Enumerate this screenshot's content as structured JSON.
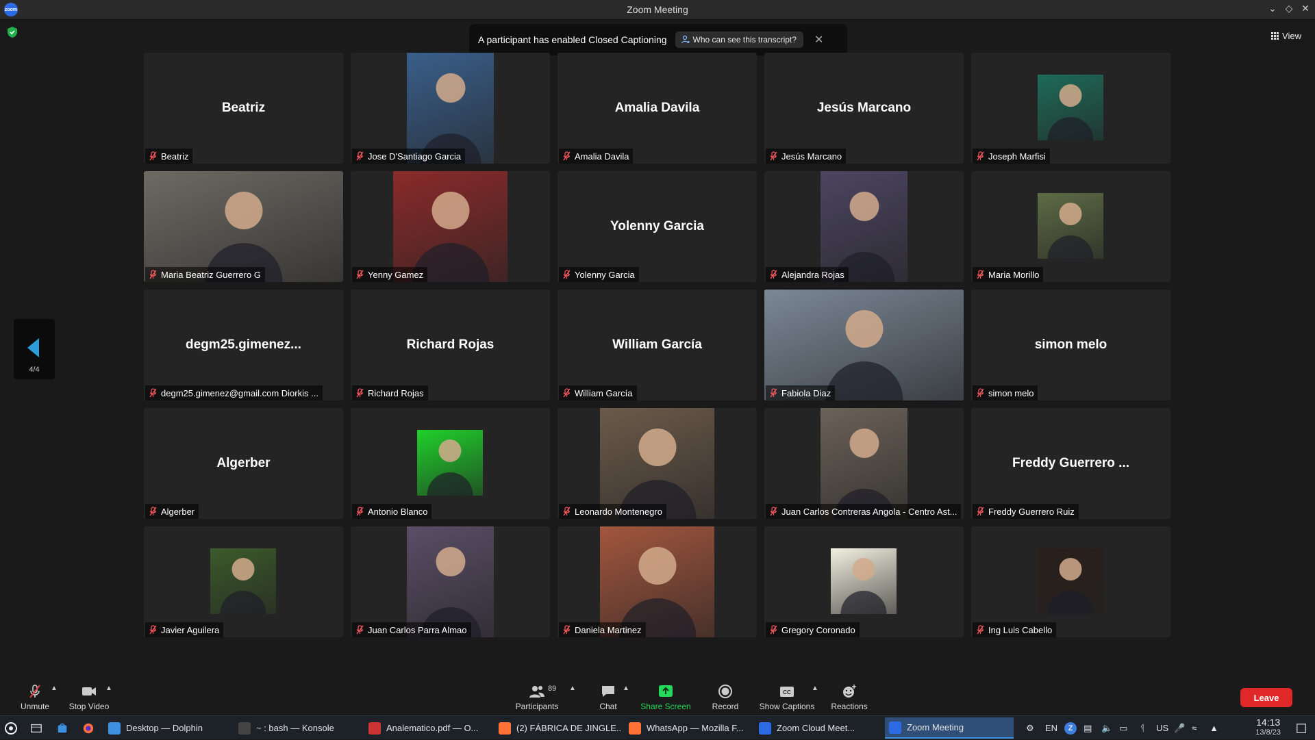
{
  "window": {
    "title": "Zoom Meeting",
    "logo_text": "zoom"
  },
  "banner": {
    "message": "A participant has enabled Closed Captioning",
    "who_label": "Who can see this transcript?"
  },
  "view": {
    "label": "View"
  },
  "pager": {
    "page": "4/4"
  },
  "tiles": [
    {
      "big": "Beatriz",
      "name": "Beatriz"
    },
    {
      "big": "",
      "name": "Jose D'Santiago Garcia",
      "video": "#3a5f8a"
    },
    {
      "big": "Amalia Davila",
      "name": "Amalia Davila"
    },
    {
      "big": "Jesús Marcano",
      "name": "Jesús Marcano"
    },
    {
      "big": "",
      "name": "Joseph Marfisi",
      "video": "#1e6b58"
    },
    {
      "big": "",
      "name": "Maria Beatriz Guerrero G",
      "video": "#6d6a63"
    },
    {
      "big": "",
      "name": "Yenny Gamez",
      "video": "#8a2a2a"
    },
    {
      "big": "Yolenny Garcia",
      "name": "Yolenny Garcia"
    },
    {
      "big": "",
      "name": "Alejandra Rojas",
      "video": "#4b4560"
    },
    {
      "big": "",
      "name": "Maria Morillo",
      "video": "#5d6b45"
    },
    {
      "big": "degm25.gimenez...",
      "name": "degm25.gimenez@gmail.com Diorkis ..."
    },
    {
      "big": "Richard Rojas",
      "name": "Richard Rojas"
    },
    {
      "big": "William García",
      "name": "William García"
    },
    {
      "big": "",
      "name": "Fabiola Diaz",
      "video": "#7b8896"
    },
    {
      "big": "simon  melo",
      "name": "simon  melo"
    },
    {
      "big": "Algerber",
      "name": "Algerber"
    },
    {
      "big": "",
      "name": "Antonio Blanco",
      "video": "#1fd12b"
    },
    {
      "big": "",
      "name": "Leonardo Montenegro",
      "video": "#6b5a4a"
    },
    {
      "big": "",
      "name": "Juan Carlos Contreras Angola - Centro Ast...",
      "video": "#6b6258"
    },
    {
      "big": "Freddy Guerrero ...",
      "name": "Freddy Guerrero Ruiz"
    },
    {
      "big": "",
      "name": "Javier Aguilera",
      "video": "#3c5a2a"
    },
    {
      "big": "",
      "name": "Juan Carlos Parra Almao",
      "video": "#5a4e66"
    },
    {
      "big": "",
      "name": "Daniela Martinez",
      "video": "#a2563e"
    },
    {
      "big": "",
      "name": "Gregory Coronado",
      "video": "#f2f0e0"
    },
    {
      "big": "",
      "name": "Ing Luis Cabello",
      "video": "#2a1f1a"
    }
  ],
  "toolbar": {
    "unmute": "Unmute",
    "stop_video": "Stop Video",
    "participants": "Participants",
    "participants_count": "89",
    "chat": "Chat",
    "share_screen": "Share Screen",
    "record": "Record",
    "show_captions": "Show Captions",
    "reactions": "Reactions",
    "leave": "Leave",
    "cc_text": "CC"
  },
  "taskbar": {
    "windows": [
      {
        "label": "Desktop — Dolphin"
      },
      {
        "label": "~ : bash — Konsole"
      },
      {
        "label": "Analematico.pdf — O..."
      },
      {
        "label": "(2) FÁBRICA DE JINGLE..."
      },
      {
        "label": "WhatsApp — Mozilla F..."
      },
      {
        "label": "Zoom Cloud Meet..."
      },
      {
        "label": "Zoom Meeting"
      }
    ],
    "lang": "EN",
    "kb": "US",
    "time": "14:13",
    "date": "13/8/23"
  },
  "colors": {
    "accent": "#2d8cff",
    "leave": "#e02828",
    "share": "#23d959",
    "mic_off": "#e0444a"
  }
}
